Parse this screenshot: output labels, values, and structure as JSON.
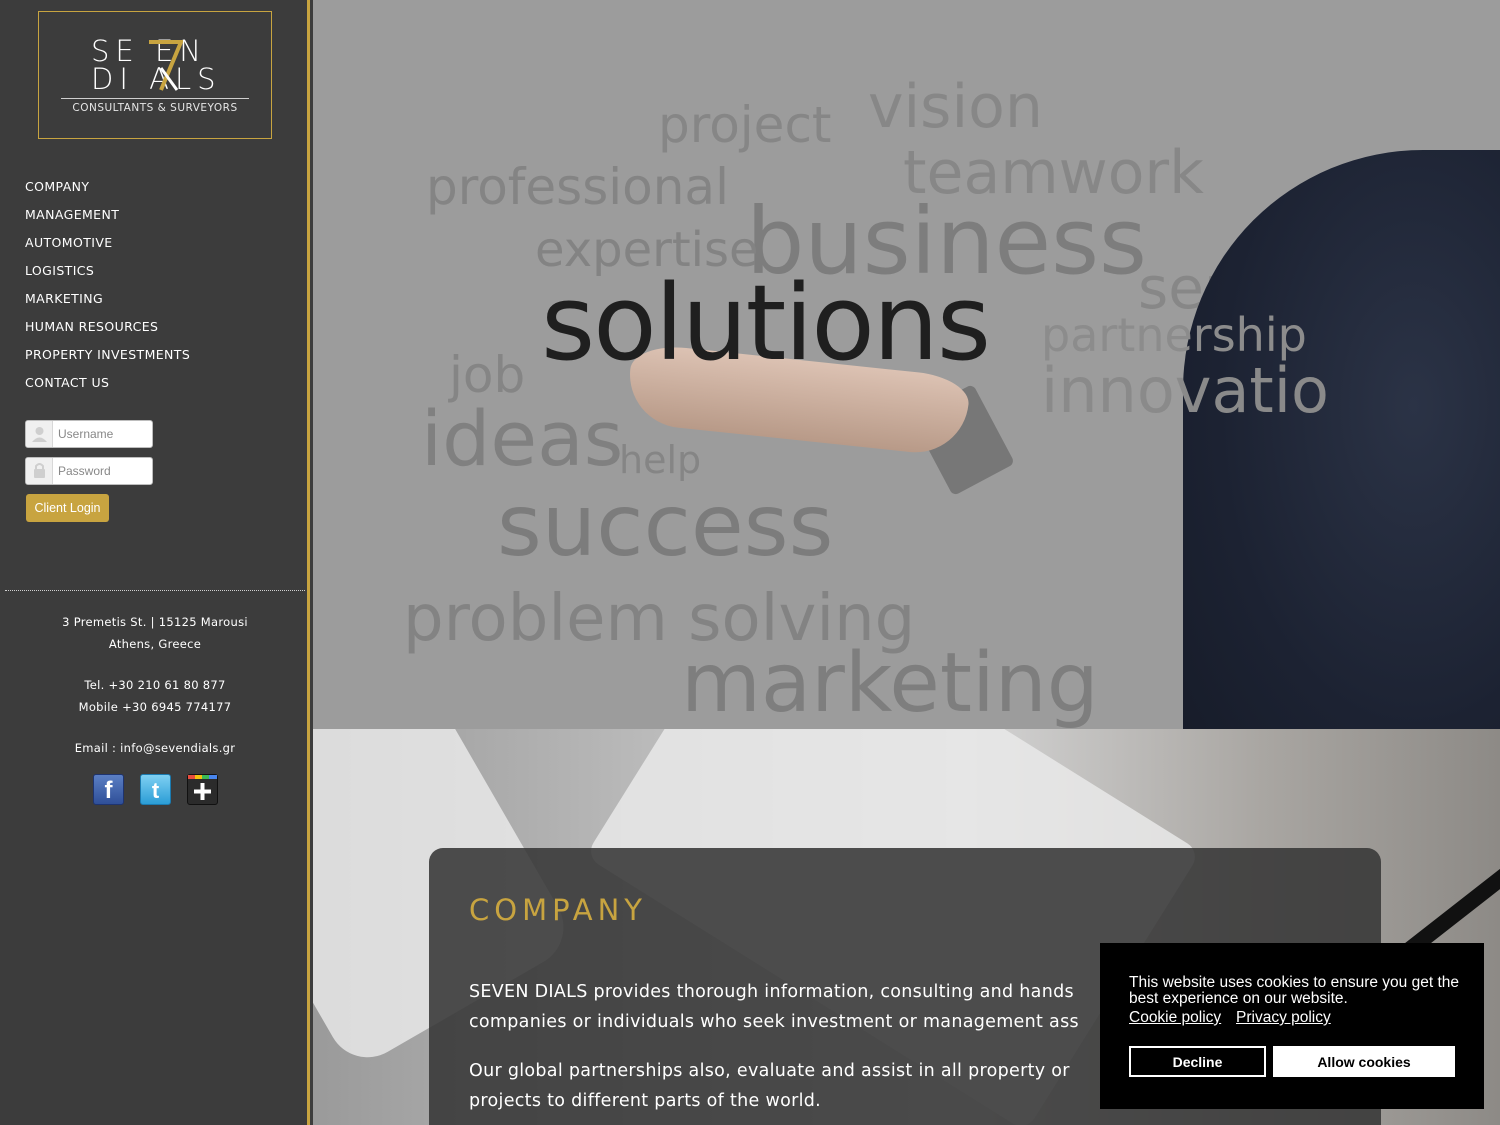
{
  "logo": {
    "line1": "SE EN",
    "line2": "DI ALS",
    "subtitle": "CONSULTANTS & SURVEYORS",
    "accent": "#c8a440"
  },
  "nav": {
    "items": [
      {
        "label": "COMPANY"
      },
      {
        "label": "MANAGEMENT"
      },
      {
        "label": "AUTOMOTIVE"
      },
      {
        "label": "LOGISTICS"
      },
      {
        "label": "MARKETING"
      },
      {
        "label": "HUMAN RESOURCES"
      },
      {
        "label": "PROPERTY INVESTMENTS"
      },
      {
        "label": "CONTACT US"
      }
    ]
  },
  "login": {
    "username_placeholder": "Username",
    "password_placeholder": "Password",
    "button_label": "Client Login",
    "user_icon": "user-icon",
    "lock_icon": "lock-icon"
  },
  "contact": {
    "address_line1": "3 Premetis St. | 15125 Marousi",
    "address_line2": "Athens, Greece",
    "tel": "Tel. +30 210 61 80 877",
    "mobile": "Mobile +30 6945 774177",
    "email": "Email : info@sevendials.gr"
  },
  "social": {
    "facebook_icon": "facebook-icon",
    "twitter_icon": "twitter-icon",
    "googleplus_icon": "google-plus-icon"
  },
  "hero": {
    "words": {
      "vision": "vision",
      "project": "project",
      "teamwork": "teamwork",
      "professional": "professional",
      "business": "business",
      "expertise": "expertise",
      "service": "service",
      "solutions": "solutions",
      "partnership": "partnership",
      "job": "job",
      "innovation": "innovatio",
      "ideas": "ideas",
      "help": "help",
      "success": "success",
      "problem_solving": "problem solving",
      "marketing": "marketing"
    }
  },
  "company": {
    "title": "COMPANY",
    "para1_line1": "SEVEN DIALS provides thorough information, consulting and hands",
    "para1_line2": "companies or individuals who seek investment or management ass",
    "para2_line1": "Our global partnerships also, evaluate and assist in all property or",
    "para2_line2": "projects to different parts of the world."
  },
  "cookie": {
    "message": "This website uses cookies to ensure you get the best experience on our website.",
    "cookie_policy": "Cookie policy",
    "privacy_policy": "Privacy policy",
    "decline": "Decline",
    "allow": "Allow cookies"
  }
}
